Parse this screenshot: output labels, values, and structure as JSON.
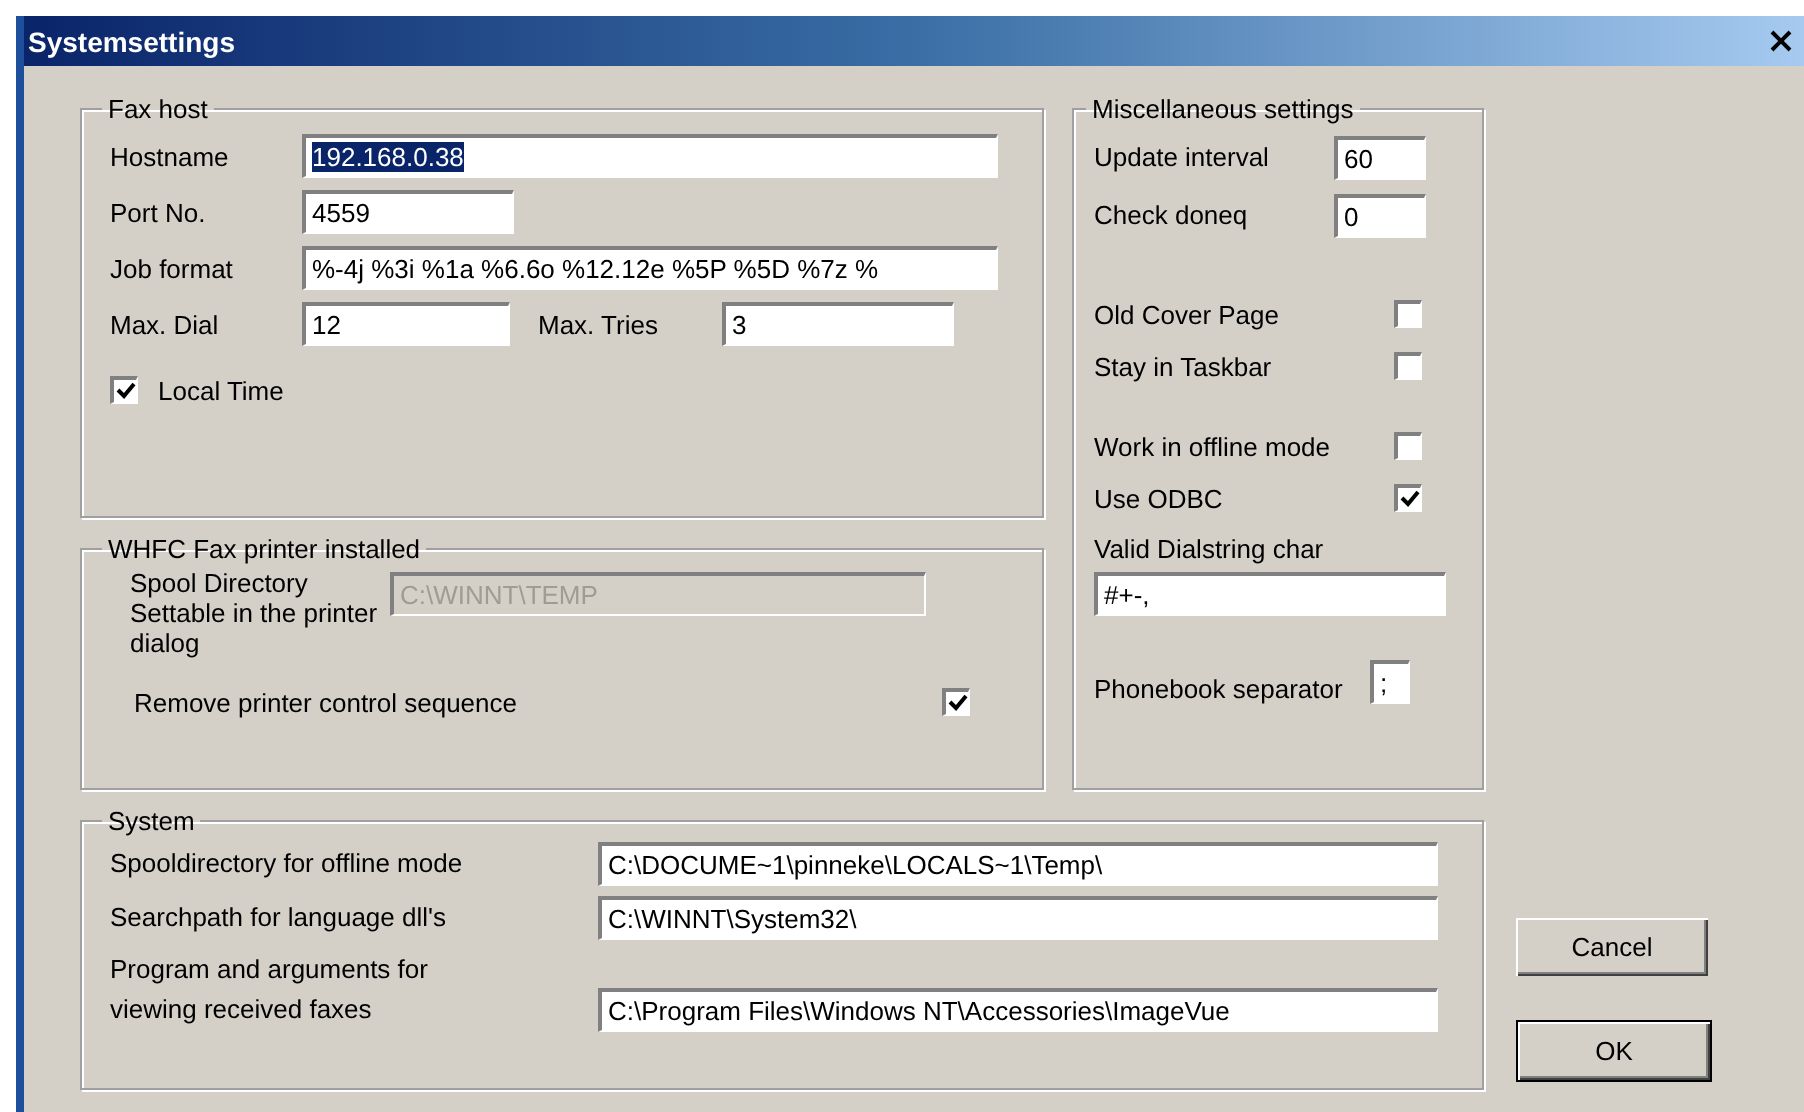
{
  "window": {
    "title": "Systemsettings"
  },
  "fax_host": {
    "title": "Fax host",
    "fields": [
      {
        "label": "Hostname",
        "value": "192.168.0.38",
        "highlighted": true
      },
      {
        "label": "Port No.",
        "value": "4559",
        "highlighted": false
      },
      {
        "label": "Job format",
        "value": "%-4j %3i %1a %6.6o %12.12e %5P %5D %7z %",
        "highlighted": false
      }
    ],
    "limits": [
      {
        "label": "Max. Dial",
        "value": "12"
      },
      {
        "label": "Max. Tries",
        "value": "3"
      }
    ],
    "local_time": {
      "label": "Local Time",
      "checked": true
    }
  },
  "printer": {
    "title": "WHFC Fax printer installed",
    "spool_label": "Spool Directory Settable in the printer dialog",
    "spool_value": "C:\\WINNT\\TEMP",
    "spool_disabled": true,
    "remove_label": "Remove printer control sequence",
    "remove_checked": true
  },
  "misc": {
    "title": "Miscellaneous settings",
    "numbers": [
      {
        "label": "Update interval",
        "value": "60"
      },
      {
        "label": "Check doneq",
        "value": "0"
      }
    ],
    "option_groups": [
      [
        {
          "label": "Old Cover Page",
          "checked": false
        },
        {
          "label": "Stay in Taskbar",
          "checked": false
        }
      ],
      [
        {
          "label": "Work in offline mode",
          "checked": false
        },
        {
          "label": "Use ODBC",
          "checked": true
        }
      ]
    ],
    "dialstring": {
      "label": "Valid Dialstring char",
      "value": "#+-,"
    },
    "separator": {
      "label": "Phonebook separator",
      "value": ";"
    }
  },
  "system": {
    "title": "System",
    "paths": [
      {
        "label": "Spooldirectory for offline mode",
        "value": "C:\\DOCUME~1\\pinneke\\LOCALS~1\\Temp\\"
      },
      {
        "label": "Searchpath for language dll's",
        "value": "C:\\WINNT\\System32\\"
      },
      {
        "label": "Program and arguments for viewing received faxes",
        "value": "C:\\Program Files\\Windows NT\\Accessories\\ImageVue"
      }
    ]
  },
  "buttons": [
    {
      "label": "Cancel",
      "default": false
    },
    {
      "label": "OK",
      "default": true
    }
  ]
}
